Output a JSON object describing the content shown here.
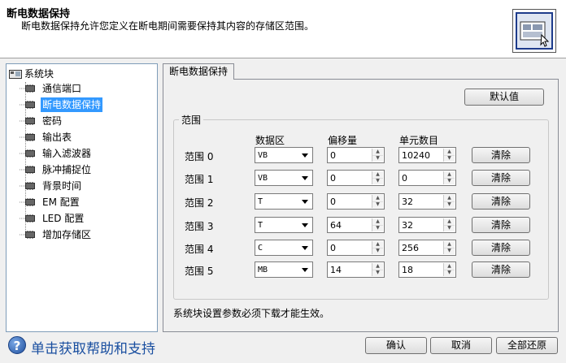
{
  "header": {
    "title": "断电数据保持",
    "description": "断电数据保持允许您定义在断电期间需要保持其内容的存储区范围。",
    "icon": "retentive-memory-icon"
  },
  "tree": {
    "root": "系统块",
    "items": [
      {
        "label": "通信端口"
      },
      {
        "label": "断电数据保持",
        "selected": true
      },
      {
        "label": "密码"
      },
      {
        "label": "输出表"
      },
      {
        "label": "输入滤波器"
      },
      {
        "label": "脉冲捕捉位"
      },
      {
        "label": "背景时间"
      },
      {
        "label": "EM 配置"
      },
      {
        "label": "LED 配置"
      },
      {
        "label": "增加存储区"
      }
    ]
  },
  "tab": {
    "label": "断电数据保持"
  },
  "defaults_button": "默认值",
  "group": {
    "label": "范围",
    "columns": {
      "data_area": "数据区",
      "offset": "偏移量",
      "count": "单元数目"
    },
    "rows": [
      {
        "label": "范围 0",
        "area": "VB",
        "offset": "0",
        "count": "10240",
        "clear": "清除"
      },
      {
        "label": "范围 1",
        "area": "VB",
        "offset": "0",
        "count": "0",
        "clear": "清除"
      },
      {
        "label": "范围 2",
        "area": "T",
        "offset": "0",
        "count": "32",
        "clear": "清除"
      },
      {
        "label": "范围 3",
        "area": "T",
        "offset": "64",
        "count": "32",
        "clear": "清除"
      },
      {
        "label": "范围 4",
        "area": "C",
        "offset": "0",
        "count": "256",
        "clear": "清除"
      },
      {
        "label": "范围 5",
        "area": "MB",
        "offset": "14",
        "count": "18",
        "clear": "清除"
      }
    ]
  },
  "note": "系统块设置参数必须下载才能生效。",
  "footer": {
    "help_text": "单击获取帮助和支持",
    "ok": "确认",
    "cancel": "取消",
    "restore_all": "全部还原"
  },
  "colors": {
    "selection": "#3399ff",
    "help_link": "#1a4fa0"
  }
}
